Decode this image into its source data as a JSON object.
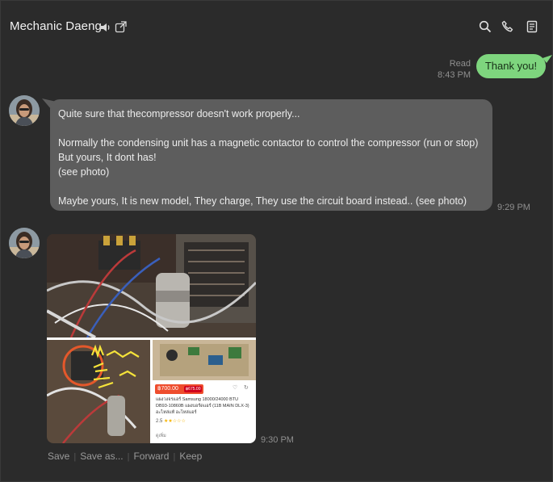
{
  "header": {
    "title": "Mechanic Daeng",
    "more_glyph": "⋮",
    "icons": [
      "speaker-icon",
      "popout-icon",
      "search-icon",
      "phone-icon",
      "notes-icon"
    ]
  },
  "messages": {
    "outgoing": {
      "text": "Thank you!",
      "read_label": "Read",
      "time": "8:43 PM"
    },
    "incoming_text": {
      "lines": [
        "Quite sure that thecompressor doesn't work properly...",
        "",
        "Normally the condensing unit has a magnetic contactor to control the compressor (run or stop)",
        "But yours, It dont has!",
        "(see photo)",
        "",
        "Maybe yours, It is new model, They charge, They use the circuit board instead.. (see photo)"
      ],
      "time": "9:29 PM"
    },
    "incoming_photo": {
      "time": "9:30 PM",
      "handwritten_annotation": "MAGNETIC CONTACTOR",
      "listing": {
        "price": "฿700.00",
        "discount_badge": "฿675.00",
        "product_text": "แผงวงจรแอร์ Samsung 18000/24000 BTU DB93-10860B แผงบอร์ดแอร์ (11B MAIN DLX-3) อะไหล่แท้ อะไหล่แอร์",
        "rating": "2.5",
        "footer": "ดูเพิ่ม"
      }
    }
  },
  "actions": {
    "save": "Save",
    "save_as": "Save as...",
    "forward": "Forward",
    "keep": "Keep",
    "separator": "|"
  },
  "colors": {
    "background": "#2b2b2b",
    "outgoing_bubble": "#7ed57e",
    "incoming_bubble": "#5d5d5d",
    "meta_text": "#8f8f8f"
  }
}
